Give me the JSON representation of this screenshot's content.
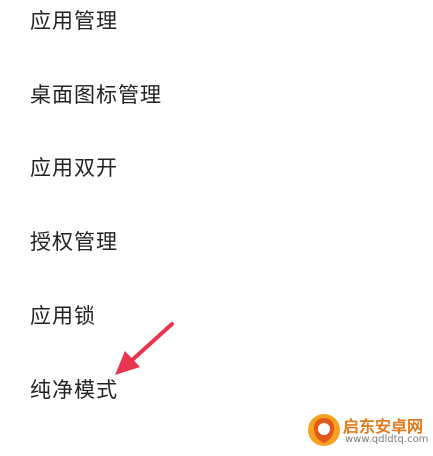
{
  "menu": {
    "items": [
      {
        "label": "应用管理"
      },
      {
        "label": "桌面图标管理"
      },
      {
        "label": "应用双开"
      },
      {
        "label": "授权管理"
      },
      {
        "label": "应用锁"
      },
      {
        "label": "纯净模式"
      }
    ]
  },
  "annotation": {
    "arrow_color": "#e8344e",
    "target": "纯净模式"
  },
  "watermark": {
    "name": "启东安卓网",
    "url": "www.qdldtq.com",
    "color": "#e07a1d"
  }
}
